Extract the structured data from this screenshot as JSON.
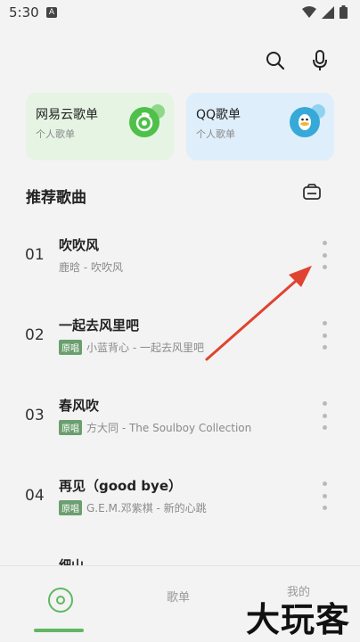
{
  "status": {
    "time": "5:30",
    "notification": "A"
  },
  "cards": [
    {
      "title": "网易云歌单",
      "subtitle": "个人歌单",
      "accent": "#4fc04a"
    },
    {
      "title": "QQ歌单",
      "subtitle": "个人歌单",
      "accent": "#36a9d9"
    }
  ],
  "section": {
    "title": "推荐歌曲"
  },
  "songs": [
    {
      "num": "01",
      "title": "吹吹风",
      "badge": "",
      "meta": "鹿晗 - 吹吹风"
    },
    {
      "num": "02",
      "title": "一起去风里吧",
      "badge": "原唱",
      "meta": "小蓝背心 - 一起去风里吧"
    },
    {
      "num": "03",
      "title": "春风吹",
      "badge": "原唱",
      "meta": "方大同 - The Soulboy Collection"
    },
    {
      "num": "04",
      "title": "再见（good bye）",
      "badge": "原唱",
      "meta": "G.E.M.邓紫棋 - 新的心跳"
    }
  ],
  "peek_title": "细山",
  "nav": {
    "playlist": "歌单",
    "mine": "我的"
  },
  "watermark": "大玩客",
  "colors": {
    "accent_green": "#5fb861",
    "arrow_red": "#e0432f"
  }
}
